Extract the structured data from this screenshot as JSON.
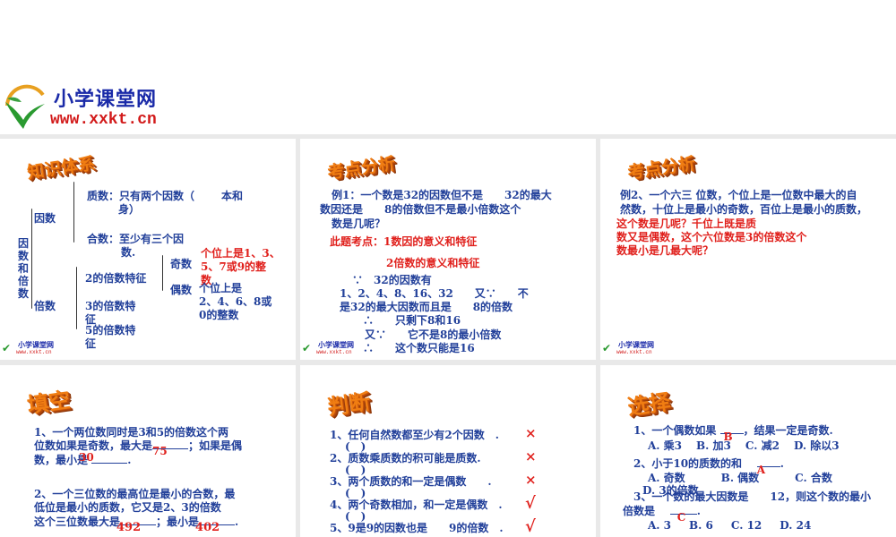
{
  "site": {
    "name": "小学课堂网",
    "url": "www.xxkt.cn"
  },
  "colors": {
    "text": "#22409a",
    "answer": "#e0201c",
    "title": "#f07d12"
  },
  "p1": {
    "title": "知识体系",
    "root": "因数和倍数",
    "factor": "因数",
    "multiple": "倍数",
    "prime": "质数：只有两个因数（",
    "prime_b": "本和",
    "prime_c": "身）",
    "composite": "合数：至少有三个因",
    "composite_b": "数.",
    "f2": "2的倍数特征",
    "f3": "3的倍数特",
    "f3b": "征",
    "f5": "5的倍数特",
    "f5b": "征",
    "odd": "奇数",
    "even": "偶数",
    "odd_rule": [
      "个位上是1、3、",
      "5、7或9的整",
      "数"
    ],
    "even_rule": [
      "个位上是",
      "2、4、6、8或",
      "0的整数"
    ]
  },
  "p2": {
    "title": "考点分析",
    "lines": [
      "例1：一个数是32的因数但不是　　32的最大",
      "数因还是　　8的倍数但不是最小倍数这个",
      "数是几呢？"
    ],
    "points": [
      "此题考点：1数因的意义和特征",
      "2倍数的意义和特征"
    ],
    "solution": [
      "∵　32的因数有",
      "1、2、4、8、16、32　　又∵　　不",
      "是32的最大因数而且是　　8的倍数",
      "∴　　只剩下8和16",
      "又∵　　它不是8的最小倍数",
      "∴　　这个数只能是16"
    ]
  },
  "p3": {
    "title": "考点分析",
    "lines": [
      "例2、一个六三 位数，个位上是一位数中最大的自",
      "然数，十位上是最小的奇数，百位上是最小的质数，"
    ],
    "red_lines": [
      "这个数是几呢？千位上既是质",
      "数又是偶数，这个六位数是3的倍数这个",
      "数最小是几最大呢？"
    ]
  },
  "p4": {
    "title": "填空",
    "q1": [
      "1、一个两位数同时是3和5的倍数这个两",
      "位数如果是奇数，最大是",
      "；如果是偶",
      "数，最小是",
      "."
    ],
    "a1": [
      "75",
      "30"
    ],
    "q2": [
      "2、一个三位数的最高位是最小的合数，最",
      "低位是最小的质数，它又是2、3的倍数",
      "这个三位数最大是",
      "；最小是",
      "."
    ],
    "a2": [
      "492",
      "402"
    ]
  },
  "p5": {
    "title": "判断",
    "items": [
      "1、任何自然数都至少有2个因数　.",
      "2、质数乘质数的积可能是质数.",
      "3、两个质数的和一定是偶数　　.",
      "4、两个奇数相加，和一定是偶数　.",
      "5、9是9的因数也是　　9的倍数　."
    ],
    "marks": [
      "×",
      "×",
      "×",
      "√",
      "√"
    ],
    "paren": "(　)"
  },
  "p6": {
    "title": "选择",
    "q1": "1、一个偶数如果",
    "q1b": "，结果一定是奇数.",
    "a1": "B",
    "o1": [
      "A. 乘3",
      "B. 加3",
      "C. 减2",
      "D. 除以3"
    ],
    "q2": "2、小于10的质数的和",
    "a2": "A",
    "o2": [
      "A. 奇数",
      "B. 偶数",
      "C. 合数",
      "D. 3的倍数"
    ],
    "q3": "3、一个数的最大因数是　　12，则这个数的最小",
    "q3b": "倍数是",
    "a3": "C",
    "o3": [
      "A. 3",
      "B. 6",
      "C. 12",
      "D. 24"
    ]
  }
}
